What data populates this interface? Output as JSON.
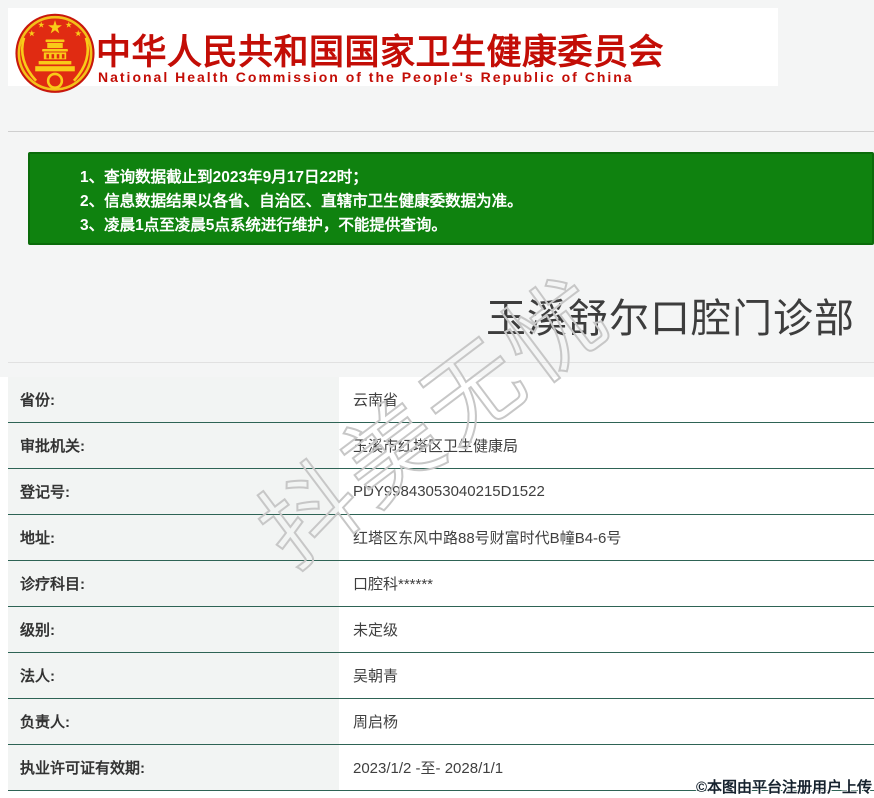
{
  "header": {
    "emblem_icon": "prc-national-emblem",
    "title_cn": "中华人民共和国国家卫生健康委员会",
    "title_en": "National Health Commission of the People's Republic of China"
  },
  "notice": {
    "lines": [
      "1、查询数据截止到2023年9月17日22时；",
      "2、信息数据结果以各省、自治区、直辖市卫生健康委数据为准。",
      "3、凌晨1点至凌晨5点系统进行维护，不能提供查询。"
    ]
  },
  "institution": {
    "name": "玉溪舒尔口腔门诊部",
    "fields": [
      {
        "label": "省份:",
        "value": "云南省"
      },
      {
        "label": "审批机关:",
        "value": "玉溪市红塔区卫生健康局"
      },
      {
        "label": "登记号:",
        "value": "PDY99843053040215D1522"
      },
      {
        "label": "地址:",
        "value": "红塔区东风中路88号财富时代B幢B4-6号"
      },
      {
        "label": "诊疗科目:",
        "value": "口腔科******"
      },
      {
        "label": "级别:",
        "value": "未定级"
      },
      {
        "label": "法人:",
        "value": "吴朝青"
      },
      {
        "label": "负责人:",
        "value": "周启杨"
      },
      {
        "label": "执业许可证有效期:",
        "value": "2023/1/2 -至- 2028/1/1"
      }
    ]
  },
  "watermark": {
    "text": "抖美无忧"
  },
  "footer": {
    "copyright": "©本图由平台注册用户上传"
  },
  "colors": {
    "header_red": "#c30d06",
    "notice_green": "#0f820f",
    "notice_border": "#0a6b0a",
    "divider_teal": "#2e6355",
    "copyright_color": "#16222e"
  }
}
